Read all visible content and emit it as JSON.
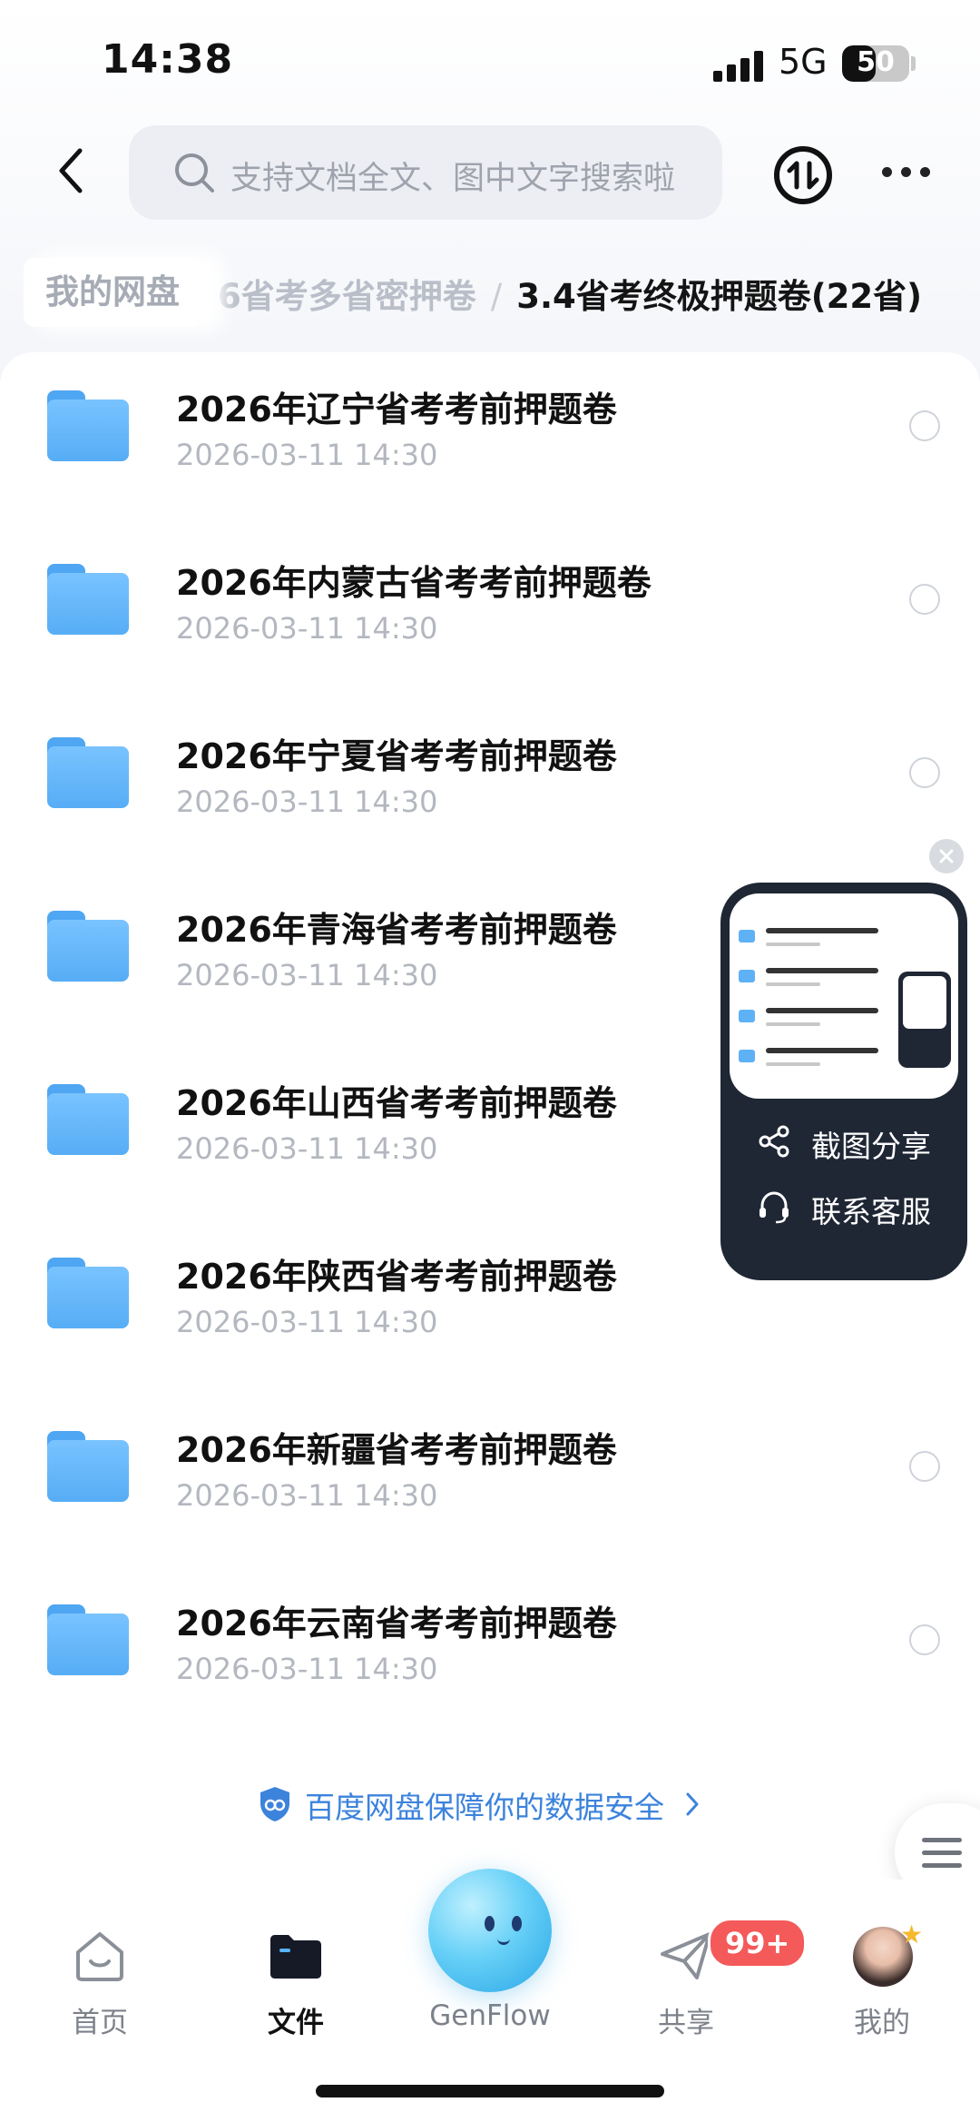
{
  "status_bar": {
    "time": "14:38",
    "network": "5G",
    "battery": "50",
    "battery_level": 0.5
  },
  "header": {
    "search_placeholder": "支持文档全文、图中文字搜索啦"
  },
  "breadcrumb": {
    "home": "我的网盘",
    "parent": "6省考多省密押卷",
    "current": "3.4省考终极押题卷(22省)"
  },
  "files": [
    {
      "name": "2026年辽宁省考考前押题卷",
      "date": "2026-03-11 14:30"
    },
    {
      "name": "2026年内蒙古省考考前押题卷",
      "date": "2026-03-11 14:30"
    },
    {
      "name": "2026年宁夏省考考前押题卷",
      "date": "2026-03-11 14:30"
    },
    {
      "name": "2026年青海省考考前押题卷",
      "date": "2026-03-11 14:30"
    },
    {
      "name": "2026年山西省考考前押题卷",
      "date": "2026-03-11 14:30"
    },
    {
      "name": "2026年陕西省考考前押题卷",
      "date": "2026-03-11 14:30"
    },
    {
      "name": "2026年新疆省考考前押题卷",
      "date": "2026-03-11 14:30"
    },
    {
      "name": "2026年云南省考考前押题卷",
      "date": "2026-03-11 14:30"
    }
  ],
  "security_note": "百度网盘保障你的数据安全",
  "float_panel": {
    "share": "截图分享",
    "support": "联系客服"
  },
  "tabs": [
    {
      "label": "首页"
    },
    {
      "label": "文件"
    },
    {
      "label": "GenFlow"
    },
    {
      "label": "共享",
      "badge": "99+"
    },
    {
      "label": "我的"
    }
  ],
  "colors": {
    "accent": "#3c83dc",
    "folder": "#5fb1f5",
    "badge": "#f45a5a",
    "panel": "#1f2634"
  }
}
